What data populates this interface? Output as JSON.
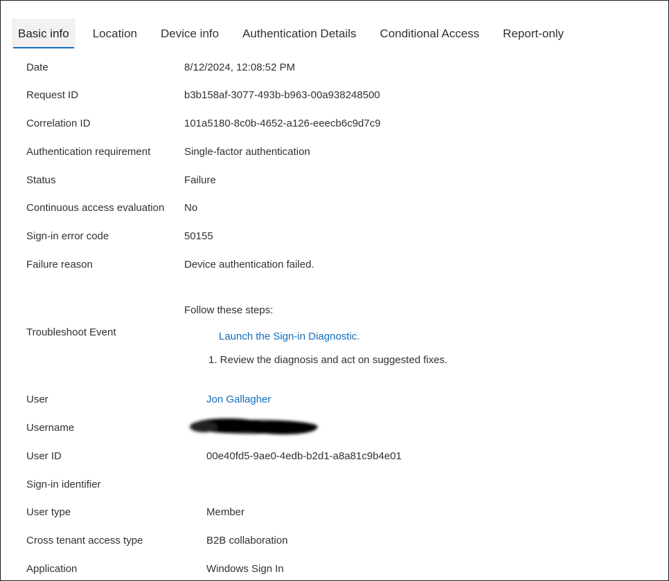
{
  "tabs": [
    {
      "label": "Basic info"
    },
    {
      "label": "Location"
    },
    {
      "label": "Device info"
    },
    {
      "label": "Authentication Details"
    },
    {
      "label": "Conditional Access"
    },
    {
      "label": "Report-only"
    }
  ],
  "fields": {
    "date": {
      "label": "Date",
      "value": "8/12/2024, 12:08:52 PM"
    },
    "request_id": {
      "label": "Request ID",
      "value": "b3b158af-3077-493b-b963-00a938248500"
    },
    "correlation_id": {
      "label": "Correlation ID",
      "value": "101a5180-8c0b-4652-a126-eeecb6c9d7c9"
    },
    "auth_requirement": {
      "label": "Authentication requirement",
      "value": "Single-factor authentication"
    },
    "status": {
      "label": "Status",
      "value": "Failure"
    },
    "cae": {
      "label": "Continuous access evaluation",
      "value": "No"
    },
    "error_code": {
      "label": "Sign-in error code",
      "value": "50155"
    },
    "failure_reason": {
      "label": "Failure reason",
      "value": "Device authentication failed."
    },
    "troubleshoot": {
      "label": "Troubleshoot Event",
      "intro": "Follow these steps:",
      "link": "Launch the Sign-in Diagnostic.",
      "step": "1. Review the diagnosis and act on suggested fixes."
    },
    "user": {
      "label": "User",
      "value": "Jon Gallagher"
    },
    "username": {
      "label": "Username"
    },
    "user_id": {
      "label": "User ID",
      "value": "00e40fd5-9ae0-4edb-b2d1-a8a81c9b4e01"
    },
    "signin_identifier": {
      "label": "Sign-in identifier",
      "value": ""
    },
    "user_type": {
      "label": "User type",
      "value": "Member"
    },
    "cross_tenant": {
      "label": "Cross tenant access type",
      "value": "B2B collaboration"
    },
    "application": {
      "label": "Application",
      "value": "Windows Sign In"
    }
  },
  "colors": {
    "accent": "#0f6cbd",
    "text": "#323130"
  }
}
